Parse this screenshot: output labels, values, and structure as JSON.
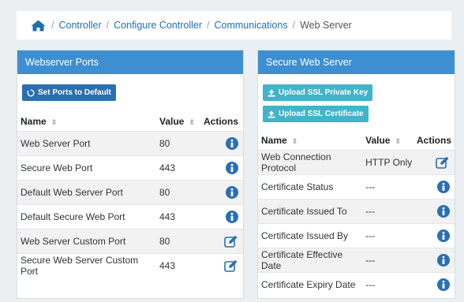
{
  "breadcrumb": {
    "items": [
      "Controller",
      "Configure Controller",
      "Communications"
    ],
    "current": "Web Server",
    "separator": "/"
  },
  "ports_panel": {
    "title": "Webserver Ports",
    "reset_button": "Set Ports to Default",
    "columns": [
      "Name",
      "Value",
      "Actions"
    ],
    "rows": [
      {
        "name": "Web Server Port",
        "value": "80",
        "action": "info"
      },
      {
        "name": "Secure Web Port",
        "value": "443",
        "action": "info"
      },
      {
        "name": "Default Web Server Port",
        "value": "80",
        "action": "info"
      },
      {
        "name": "Default Secure Web Port",
        "value": "443",
        "action": "info"
      },
      {
        "name": "Web Server Custom Port",
        "value": "80",
        "action": "edit"
      },
      {
        "name": "Secure Web Server Custom Port",
        "value": "443",
        "action": "edit"
      }
    ]
  },
  "secure_panel": {
    "title": "Secure Web Server",
    "upload_key_button": "Upload SSL Private Key",
    "upload_cert_button": "Upload SSL Certificate",
    "columns": [
      "Name",
      "Value",
      "Actions"
    ],
    "rows": [
      {
        "name": "Web Connection Protocol",
        "value": "HTTP Only",
        "action": "edit"
      },
      {
        "name": "Certificate Status",
        "value": "---",
        "action": "info"
      },
      {
        "name": "Certificate Issued To",
        "value": "---",
        "action": "info"
      },
      {
        "name": "Certificate Issued By",
        "value": "---",
        "action": "info"
      },
      {
        "name": "Certificate Effective Date",
        "value": "---",
        "action": "info"
      },
      {
        "name": "Certificate Expiry Date",
        "value": "---",
        "action": "info"
      }
    ]
  },
  "colors": {
    "panel_header": "#3d8fd1",
    "primary_button": "#2c6fae",
    "info_button": "#41b4c9",
    "link": "#1f6fb3",
    "icon_blue": "#2a6fb5"
  }
}
